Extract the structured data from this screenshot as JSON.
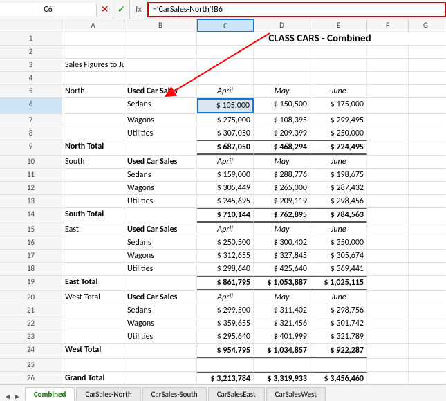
{
  "nameBox": "C6",
  "formula": "='CarSales-North'!B6",
  "title": "CLASS CARS - Combined",
  "columns": [
    "",
    "A",
    "B",
    "C",
    "D",
    "E",
    "F",
    "G"
  ],
  "colWidths": [
    "row-num-header",
    "col-a",
    "col-b",
    "col-c",
    "col-d",
    "col-e",
    "col-f",
    "col-g"
  ],
  "rows": [
    {
      "num": 1,
      "cells": [
        {
          "cls": "col-a"
        },
        {
          "cls": "col-b"
        },
        {
          "cls": "col-c title center bold",
          "span": 5,
          "text": "CLASS CARS - Combined"
        },
        {
          "cls": "col-d"
        },
        {
          "cls": "col-e"
        },
        {
          "cls": "col-f"
        },
        {
          "cls": "col-g"
        }
      ]
    },
    {
      "num": 2,
      "cells": [
        {
          "cls": "col-a"
        },
        {
          "cls": "col-b"
        },
        {
          "cls": "col-c"
        },
        {
          "cls": "col-d"
        },
        {
          "cls": "col-e"
        },
        {
          "cls": "col-f"
        },
        {
          "cls": "col-g"
        }
      ]
    },
    {
      "num": 3,
      "cells": [
        {
          "cls": "col-a",
          "text": "Sales Figures to June"
        },
        {
          "cls": "col-b"
        },
        {
          "cls": "col-c"
        },
        {
          "cls": "col-d"
        },
        {
          "cls": "col-e"
        },
        {
          "cls": "col-f"
        },
        {
          "cls": "col-g"
        }
      ]
    },
    {
      "num": 4,
      "cells": [
        {
          "cls": "col-a"
        },
        {
          "cls": "col-b"
        },
        {
          "cls": "col-c"
        },
        {
          "cls": "col-d"
        },
        {
          "cls": "col-e"
        },
        {
          "cls": "col-f"
        },
        {
          "cls": "col-g"
        }
      ]
    },
    {
      "num": 5,
      "cells": [
        {
          "cls": "col-a",
          "text": "North"
        },
        {
          "cls": "col-b bold",
          "text": "Used Car Sales"
        },
        {
          "cls": "col-c italic center",
          "text": "April"
        },
        {
          "cls": "col-d italic center",
          "text": "May"
        },
        {
          "cls": "col-e italic center",
          "text": "June"
        },
        {
          "cls": "col-f"
        },
        {
          "cls": "col-g"
        }
      ]
    },
    {
      "num": 6,
      "cells": [
        {
          "cls": "col-a"
        },
        {
          "cls": "col-b",
          "text": "Sedans"
        },
        {
          "cls": "col-c selected-cell right",
          "text": "$   105,000"
        },
        {
          "cls": "col-d right",
          "text": "$   150,500"
        },
        {
          "cls": "col-e right",
          "text": "$   175,000"
        },
        {
          "cls": "col-f"
        },
        {
          "cls": "col-g"
        }
      ]
    },
    {
      "num": 7,
      "cells": [
        {
          "cls": "col-a"
        },
        {
          "cls": "col-b",
          "text": "Wagons"
        },
        {
          "cls": "col-c right",
          "text": "$   275,000"
        },
        {
          "cls": "col-d right",
          "text": "$   108,395"
        },
        {
          "cls": "col-e right",
          "text": "$   299,495"
        },
        {
          "cls": "col-f"
        },
        {
          "cls": "col-g"
        }
      ]
    },
    {
      "num": 8,
      "cells": [
        {
          "cls": "col-a"
        },
        {
          "cls": "col-b",
          "text": "Utilities"
        },
        {
          "cls": "col-c right",
          "text": "$   307,050"
        },
        {
          "cls": "col-d right",
          "text": "$   209,399"
        },
        {
          "cls": "col-e right",
          "text": "$   250,000"
        },
        {
          "cls": "col-f"
        },
        {
          "cls": "col-g"
        }
      ]
    },
    {
      "num": 9,
      "cells": [
        {
          "cls": "col-a bold",
          "text": "North Total"
        },
        {
          "cls": "col-b"
        },
        {
          "cls": "col-c right bold",
          "text": "$   687,050"
        },
        {
          "cls": "col-d right bold",
          "text": "$   468,294"
        },
        {
          "cls": "col-e right bold",
          "text": "$   724,495"
        },
        {
          "cls": "col-f"
        },
        {
          "cls": "col-g"
        }
      ]
    },
    {
      "num": 10,
      "cells": [
        {
          "cls": "col-a",
          "text": "South"
        },
        {
          "cls": "col-b bold",
          "text": "Used Car Sales"
        },
        {
          "cls": "col-c italic center",
          "text": "April"
        },
        {
          "cls": "col-d italic center",
          "text": "May"
        },
        {
          "cls": "col-e italic center",
          "text": "June"
        },
        {
          "cls": "col-f"
        },
        {
          "cls": "col-g"
        }
      ]
    },
    {
      "num": 11,
      "cells": [
        {
          "cls": "col-a"
        },
        {
          "cls": "col-b",
          "text": "Sedans"
        },
        {
          "cls": "col-c right",
          "text": "$   159,000"
        },
        {
          "cls": "col-d right",
          "text": "$   288,776"
        },
        {
          "cls": "col-e right",
          "text": "$   198,675"
        },
        {
          "cls": "col-f"
        },
        {
          "cls": "col-g"
        }
      ]
    },
    {
      "num": 12,
      "cells": [
        {
          "cls": "col-a"
        },
        {
          "cls": "col-b",
          "text": "Wagons"
        },
        {
          "cls": "col-c right",
          "text": "$   305,449"
        },
        {
          "cls": "col-d right",
          "text": "$   265,000"
        },
        {
          "cls": "col-e right",
          "text": "$   287,432"
        },
        {
          "cls": "col-f"
        },
        {
          "cls": "col-g"
        }
      ]
    },
    {
      "num": 13,
      "cells": [
        {
          "cls": "col-a"
        },
        {
          "cls": "col-b",
          "text": "Utilities"
        },
        {
          "cls": "col-c right",
          "text": "$   245,695"
        },
        {
          "cls": "col-d right",
          "text": "$   209,119"
        },
        {
          "cls": "col-e right",
          "text": "$   298,456"
        },
        {
          "cls": "col-f"
        },
        {
          "cls": "col-g"
        }
      ]
    },
    {
      "num": 14,
      "cells": [
        {
          "cls": "col-a bold",
          "text": "South Total"
        },
        {
          "cls": "col-b"
        },
        {
          "cls": "col-c right bold",
          "text": "$   710,144"
        },
        {
          "cls": "col-d right bold",
          "text": "$   762,895"
        },
        {
          "cls": "col-e right bold",
          "text": "$   784,563"
        },
        {
          "cls": "col-f"
        },
        {
          "cls": "col-g"
        }
      ]
    },
    {
      "num": 15,
      "cells": [
        {
          "cls": "col-a",
          "text": "East"
        },
        {
          "cls": "col-b bold",
          "text": "Used Car Sales"
        },
        {
          "cls": "col-c italic center",
          "text": "April"
        },
        {
          "cls": "col-d italic center",
          "text": "May"
        },
        {
          "cls": "col-e italic center",
          "text": "June"
        },
        {
          "cls": "col-f"
        },
        {
          "cls": "col-g"
        }
      ]
    },
    {
      "num": 16,
      "cells": [
        {
          "cls": "col-a"
        },
        {
          "cls": "col-b",
          "text": "Sedans"
        },
        {
          "cls": "col-c right",
          "text": "$   250,500"
        },
        {
          "cls": "col-d right",
          "text": "$   300,402"
        },
        {
          "cls": "col-e right",
          "text": "$   350,000"
        },
        {
          "cls": "col-f"
        },
        {
          "cls": "col-g"
        }
      ]
    },
    {
      "num": 17,
      "cells": [
        {
          "cls": "col-a"
        },
        {
          "cls": "col-b",
          "text": "Wagons"
        },
        {
          "cls": "col-c right",
          "text": "$   312,655"
        },
        {
          "cls": "col-d right",
          "text": "$   327,845"
        },
        {
          "cls": "col-e right",
          "text": "$   305,674"
        },
        {
          "cls": "col-f"
        },
        {
          "cls": "col-g"
        }
      ]
    },
    {
      "num": 18,
      "cells": [
        {
          "cls": "col-a"
        },
        {
          "cls": "col-b",
          "text": "Utilities"
        },
        {
          "cls": "col-c right",
          "text": "$   298,640"
        },
        {
          "cls": "col-d right",
          "text": "$   425,640"
        },
        {
          "cls": "col-e right",
          "text": "$   369,441"
        },
        {
          "cls": "col-f"
        },
        {
          "cls": "col-g"
        }
      ]
    },
    {
      "num": 19,
      "cells": [
        {
          "cls": "col-a bold",
          "text": "East Total"
        },
        {
          "cls": "col-b"
        },
        {
          "cls": "col-c right bold",
          "text": "$   861,795"
        },
        {
          "cls": "col-d right bold",
          "text": "$ 1,053,887"
        },
        {
          "cls": "col-e right bold",
          "text": "$ 1,025,115"
        },
        {
          "cls": "col-f"
        },
        {
          "cls": "col-g"
        }
      ]
    },
    {
      "num": 20,
      "cells": [
        {
          "cls": "col-a",
          "text": "West Total"
        },
        {
          "cls": "col-b bold",
          "text": "Used Car Sales"
        },
        {
          "cls": "col-c italic center",
          "text": "April"
        },
        {
          "cls": "col-d italic center",
          "text": "May"
        },
        {
          "cls": "col-e italic center",
          "text": "June"
        },
        {
          "cls": "col-f"
        },
        {
          "cls": "col-g"
        }
      ]
    },
    {
      "num": 21,
      "cells": [
        {
          "cls": "col-a"
        },
        {
          "cls": "col-b",
          "text": "Sedans"
        },
        {
          "cls": "col-c right",
          "text": "$   299,500"
        },
        {
          "cls": "col-d right",
          "text": "$   311,402"
        },
        {
          "cls": "col-e right",
          "text": "$   298,756"
        },
        {
          "cls": "col-f"
        },
        {
          "cls": "col-g"
        }
      ]
    },
    {
      "num": 22,
      "cells": [
        {
          "cls": "col-a"
        },
        {
          "cls": "col-b",
          "text": "Wagons"
        },
        {
          "cls": "col-c right",
          "text": "$   359,655"
        },
        {
          "cls": "col-d right",
          "text": "$   321,456"
        },
        {
          "cls": "col-e right",
          "text": "$   301,742"
        },
        {
          "cls": "col-f"
        },
        {
          "cls": "col-g"
        }
      ]
    },
    {
      "num": 23,
      "cells": [
        {
          "cls": "col-a"
        },
        {
          "cls": "col-b",
          "text": "Utilities"
        },
        {
          "cls": "col-c right",
          "text": "$   295,640"
        },
        {
          "cls": "col-d right",
          "text": "$   401,999"
        },
        {
          "cls": "col-e right",
          "text": "$   321,789"
        },
        {
          "cls": "col-f"
        },
        {
          "cls": "col-g"
        }
      ]
    },
    {
      "num": 24,
      "cells": [
        {
          "cls": "col-a bold",
          "text": "West Total"
        },
        {
          "cls": "col-b"
        },
        {
          "cls": "col-c right bold",
          "text": "$   954,795"
        },
        {
          "cls": "col-d right bold",
          "text": "$ 1,034,857"
        },
        {
          "cls": "col-e right bold",
          "text": "$   922,287"
        },
        {
          "cls": "col-f"
        },
        {
          "cls": "col-g"
        }
      ]
    },
    {
      "num": 25,
      "cells": [
        {
          "cls": "col-a"
        },
        {
          "cls": "col-b"
        },
        {
          "cls": "col-c"
        },
        {
          "cls": "col-d"
        },
        {
          "cls": "col-e"
        },
        {
          "cls": "col-f"
        },
        {
          "cls": "col-g"
        }
      ]
    },
    {
      "num": 26,
      "cells": [
        {
          "cls": "col-a bold",
          "text": "Grand Total"
        },
        {
          "cls": "col-b"
        },
        {
          "cls": "col-c right bold",
          "text": "$ 3,213,784"
        },
        {
          "cls": "col-d right bold",
          "text": "$ 3,319,933"
        },
        {
          "cls": "col-e right bold",
          "text": "$ 3,456,460"
        },
        {
          "cls": "col-f"
        },
        {
          "cls": "col-g"
        }
      ]
    },
    {
      "num": 27,
      "cells": [
        {
          "cls": "col-a"
        },
        {
          "cls": "col-b"
        },
        {
          "cls": "col-c"
        },
        {
          "cls": "col-d"
        },
        {
          "cls": "col-e"
        },
        {
          "cls": "col-f"
        },
        {
          "cls": "col-g"
        }
      ]
    }
  ],
  "tabs": [
    {
      "label": "Combined",
      "active": true
    },
    {
      "label": "CarSales-North",
      "active": false
    },
    {
      "label": "CarSales-South",
      "active": false
    },
    {
      "label": "CarSalesEast",
      "active": false
    },
    {
      "label": "CarSalesWest",
      "active": false
    }
  ],
  "tabNav": [
    "◄",
    "►"
  ],
  "cancelBtn": "✕",
  "acceptBtn": "✓",
  "fnLabel": "fx"
}
